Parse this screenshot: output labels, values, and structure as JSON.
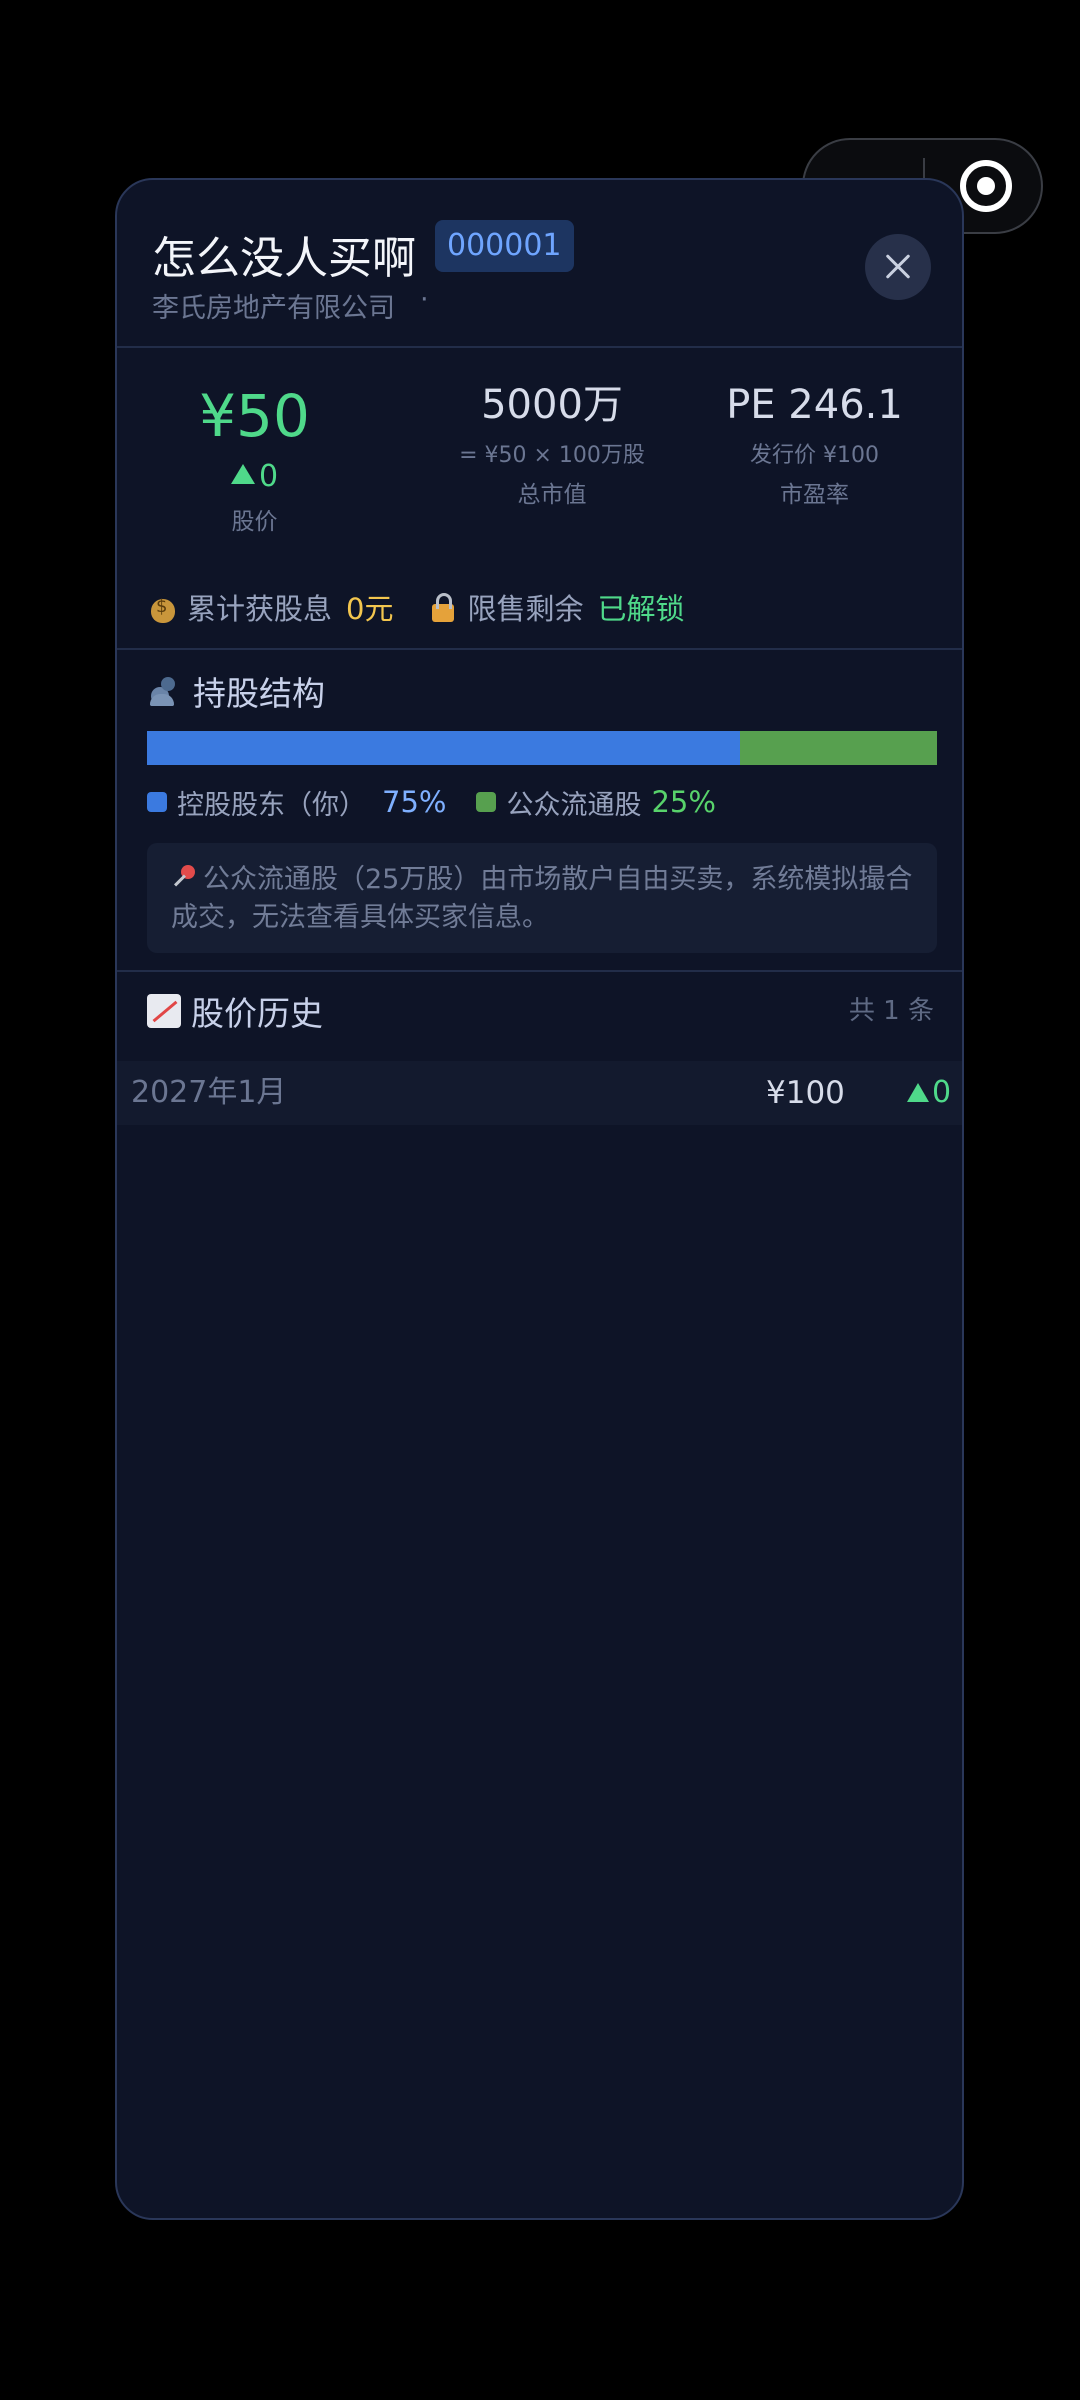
{
  "stock": {
    "name": "怎么没人买啊",
    "code": "000001",
    "company": "李氏房地产有限公司",
    "company_suffix": "·"
  },
  "stats": {
    "price": "¥50",
    "price_change": "0",
    "price_label": "股价",
    "market_cap": "5000万",
    "market_cap_formula": "= ¥50 × 100万股",
    "market_cap_label": "总市值",
    "pe": "PE 246.1",
    "issue_price": "发行价 ¥100",
    "pe_label": "市盈率"
  },
  "dividend": {
    "label": "累计获股息",
    "value": "0元",
    "lock_label": "限售剩余",
    "lock_value": "已解锁"
  },
  "holding": {
    "title": "持股结构",
    "controller_label": "控股股东（你）",
    "controller_pct": "75%",
    "controller_fraction": 0.75,
    "public_label": "公众流通股",
    "public_pct": "25%",
    "public_fraction": 0.25,
    "note": "公众流通股（25万股）由市场散户自由买卖，系统模拟撮合成交，无法查看具体买家信息。"
  },
  "history": {
    "title": "股价历史",
    "count": "共 1 条",
    "rows": [
      {
        "date": "2027年1月",
        "price": "¥100",
        "change": "0"
      }
    ]
  },
  "colors": {
    "up": "#4fd98a",
    "controller": "#3b7ae0",
    "public": "#57a04f",
    "dividend": "#f3c64e"
  },
  "icons": [
    "more-icon",
    "target-icon",
    "close-icon",
    "money-bag-icon",
    "lock-icon",
    "people-icon",
    "pin-icon",
    "chart-up-icon"
  ]
}
